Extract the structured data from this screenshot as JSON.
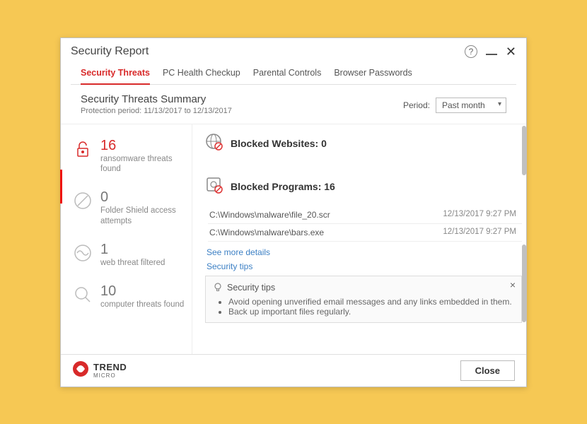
{
  "window": {
    "title": "Security Report"
  },
  "tabs": [
    "Security Threats",
    "PC Health Checkup",
    "Parental Controls",
    "Browser Passwords"
  ],
  "summary": {
    "title": "Security Threats Summary",
    "protection_period": "Protection period: 11/13/2017 to 12/13/2017",
    "period_label": "Period:",
    "period_value": "Past month"
  },
  "stats": {
    "ransomware": {
      "count": "16",
      "label": "ransomware threats found"
    },
    "folder_shield": {
      "count": "0",
      "label": "Folder Shield access attempts"
    },
    "web_threat": {
      "count": "1",
      "label": "web threat filtered"
    },
    "computer_threats": {
      "count": "10",
      "label": "computer threats found"
    }
  },
  "blocked_websites": {
    "title": "Blocked Websites: 0"
  },
  "blocked_programs": {
    "title": "Blocked Programs: 16",
    "rows": [
      {
        "path": "C:\\Windows\\malware\\file_20.scr",
        "time": "12/13/2017 9:27 PM"
      },
      {
        "path": "C:\\Windows\\malware\\bars.exe",
        "time": "12/13/2017 9:27 PM"
      }
    ],
    "see_more": "See more details",
    "security_tips_link": "Security tips"
  },
  "tips": {
    "title": "Security tips",
    "items": [
      "Avoid opening unverified email messages and any links embedded in them.",
      "Back up important files regularly."
    ]
  },
  "footer": {
    "brand_top": "TREND",
    "brand_bottom": "MICRO",
    "close": "Close"
  }
}
